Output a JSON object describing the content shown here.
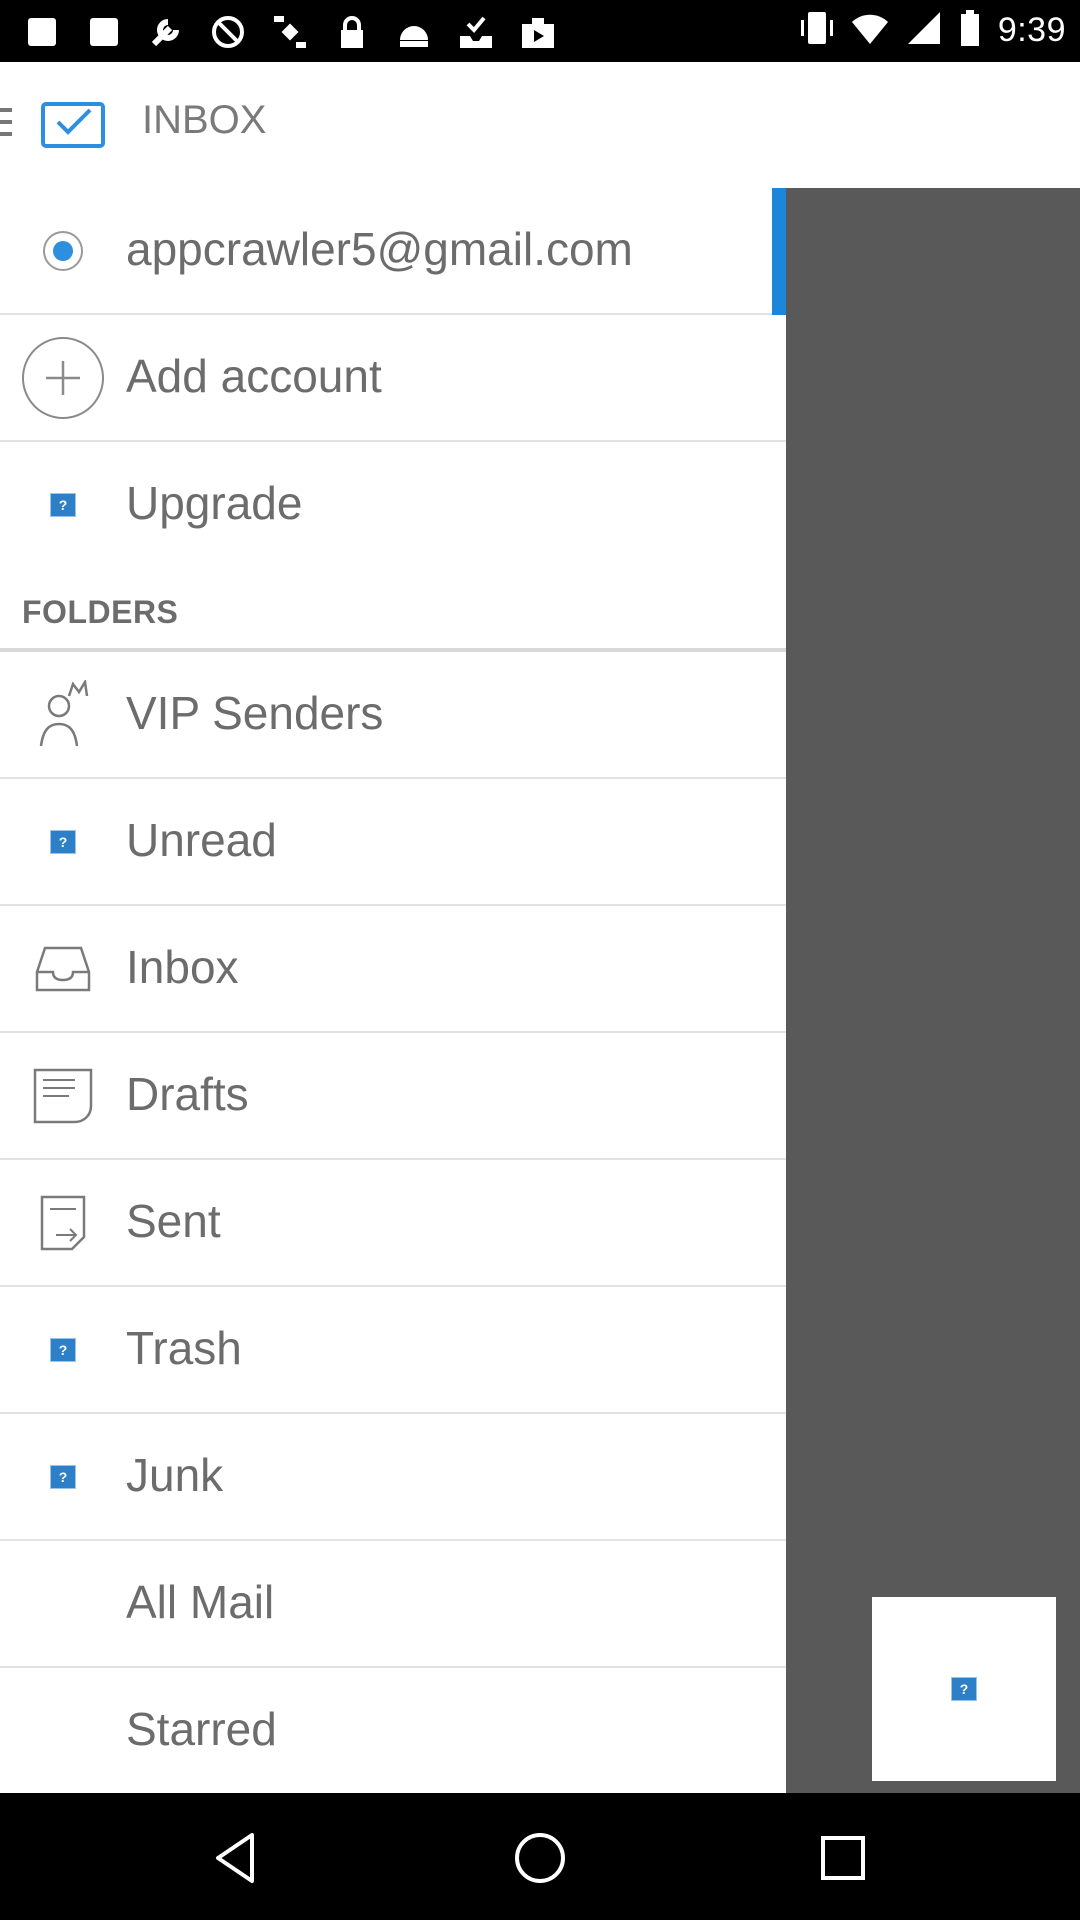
{
  "status_bar": {
    "time": "9:39",
    "left_icons": [
      "image-icon",
      "image-icon",
      "wrench-icon",
      "block-icon",
      "satellite-icon",
      "lock-icon",
      "android-icon",
      "inbox-check-icon",
      "play-icon"
    ],
    "right_icons": [
      "vibrate-icon",
      "wifi-icon",
      "signal-icon",
      "battery-icon"
    ]
  },
  "app_bar": {
    "title": "INBOX",
    "icon": "mail-check-icon"
  },
  "drawer": {
    "account": {
      "email": "appcrawler5@gmail.com",
      "icon": "radio-selected-icon"
    },
    "add_account": {
      "label": "Add account",
      "icon": "plus-circle-icon"
    },
    "upgrade": {
      "label": "Upgrade",
      "icon": "broken-image-icon"
    },
    "folders_header": "FOLDERS",
    "folders": [
      {
        "label": "VIP Senders",
        "icon": "vip-user-icon"
      },
      {
        "label": "Unread",
        "icon": "broken-image-icon"
      },
      {
        "label": "Inbox",
        "icon": "inbox-tray-icon"
      },
      {
        "label": "Drafts",
        "icon": "drafts-icon"
      },
      {
        "label": "Sent",
        "icon": "sent-icon"
      },
      {
        "label": "Trash",
        "icon": "broken-image-icon"
      },
      {
        "label": "Junk",
        "icon": "broken-image-icon"
      },
      {
        "label": "All Mail",
        "icon": ""
      },
      {
        "label": "Starred",
        "icon": ""
      }
    ]
  },
  "nav_bar": {
    "buttons": [
      "back-icon",
      "home-icon",
      "recents-icon"
    ]
  },
  "colors": {
    "accent": "#1e86d9",
    "scrim": "#595959",
    "text": "#6c6c6c"
  }
}
